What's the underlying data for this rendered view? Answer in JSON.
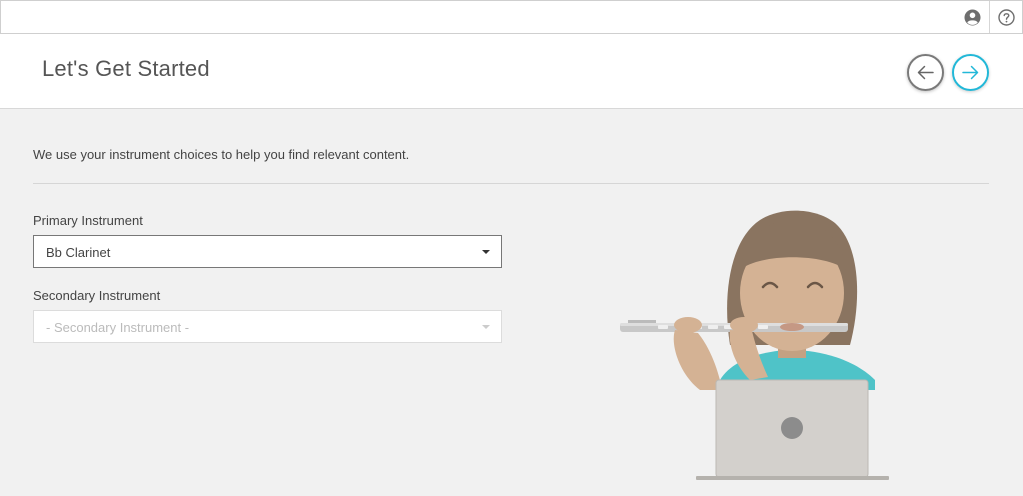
{
  "topbar": {
    "icons": [
      "account-circle-icon",
      "help-circle-icon"
    ]
  },
  "header": {
    "title": "Let's Get Started",
    "back_icon": "arrow-left-icon",
    "next_icon": "arrow-right-icon"
  },
  "main": {
    "intro": "We use your instrument choices to help you find relevant content.",
    "primary": {
      "label": "Primary Instrument",
      "value": "Bb Clarinet"
    },
    "secondary": {
      "label": "Secondary Instrument",
      "placeholder": "- Secondary Instrument -"
    }
  },
  "colors": {
    "accent": "#22b8d8",
    "background": "#f1f1f1"
  }
}
